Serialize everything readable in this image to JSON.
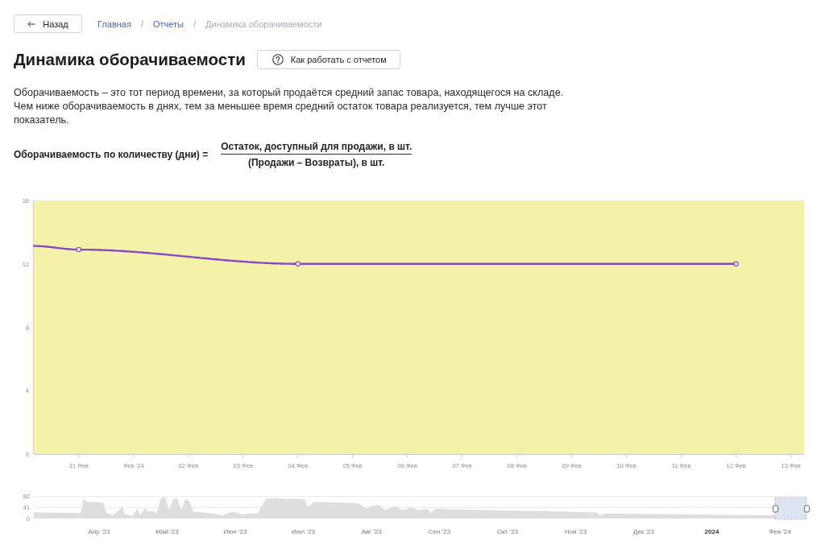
{
  "back_button": {
    "label": "Назад"
  },
  "breadcrumbs": {
    "separator": "/",
    "items": [
      {
        "label": "Главная",
        "current": false
      },
      {
        "label": "Отчеты",
        "current": false
      },
      {
        "label": "Динамика оборачиваемости",
        "current": true
      }
    ]
  },
  "title": "Динамика оборачиваемости",
  "help_button": {
    "label": "Как работать с отчетом"
  },
  "description": [
    "Оборачиваемость – это тот период времени, за который продаётся средний запас товара, находящегося на складе.",
    "Чем ниже оборачиваемость в днях, тем за меньшее время средний остаток товара реализуется, тем лучше этот показатель."
  ],
  "formula": {
    "label": "Оборачиваемость по количеству (дни) =",
    "numerator": "Остаток, доступный для продажи, в шт.",
    "denominator": "(Продажи – Возвраты), в шт."
  },
  "chart": {
    "chart_data": {
      "type": "line",
      "x": [
        "2024-01-30T04:19:00Z",
        "2024-01-31",
        "2024-02-04",
        "2024-02-12"
      ],
      "series": [
        {
          "color": "#8648c4",
          "values": [
            13.13,
            12.9,
            12,
            12
          ]
        }
      ],
      "xlim": [
        "2024-01-30T04:19:00Z",
        "2024-02-13T05:46:00Z"
      ],
      "ylim": [
        0,
        16
      ],
      "xticks": [
        {
          "value": "2024-01-31",
          "label": "31 Янв"
        },
        {
          "value": "2024-02-01",
          "label": "Фев '24"
        },
        {
          "value": "2024-02-02",
          "label": "02 Фев"
        },
        {
          "value": "2024-02-03",
          "label": "03 Фев"
        },
        {
          "value": "2024-02-04",
          "label": "04 Фев"
        },
        {
          "value": "2024-02-05",
          "label": "05 Фев"
        },
        {
          "value": "2024-02-06",
          "label": "06 Фев"
        },
        {
          "value": "2024-02-07",
          "label": "07 Фев"
        },
        {
          "value": "2024-02-08",
          "label": "08 Фев"
        },
        {
          "value": "2024-02-09",
          "label": "09 Фев"
        },
        {
          "value": "2024-02-10",
          "label": "10 Фев"
        },
        {
          "value": "2024-02-11",
          "label": "11 Фев"
        },
        {
          "value": "2024-02-12",
          "label": "12 Фев"
        },
        {
          "value": "2024-02-13",
          "label": "13 Фев"
        }
      ],
      "yticks": [
        0,
        4,
        8,
        12,
        16
      ]
    }
  },
  "navigator": {
    "y_labels": [
      "82",
      "41",
      "0"
    ],
    "x_labels": [
      {
        "label": "Апр '23",
        "bold": false
      },
      {
        "label": "Май '23",
        "bold": false
      },
      {
        "label": "Июн '23",
        "bold": false
      },
      {
        "label": "Июл '23",
        "bold": false
      },
      {
        "label": "Авг '23",
        "bold": false
      },
      {
        "label": "Сен '23",
        "bold": false
      },
      {
        "label": "Окт '23",
        "bold": false
      },
      {
        "label": "Ноя '23",
        "bold": false
      },
      {
        "label": "Дек '23",
        "bold": false
      },
      {
        "label": "2024",
        "bold": true
      },
      {
        "label": "Фев '24",
        "bold": false
      }
    ]
  }
}
